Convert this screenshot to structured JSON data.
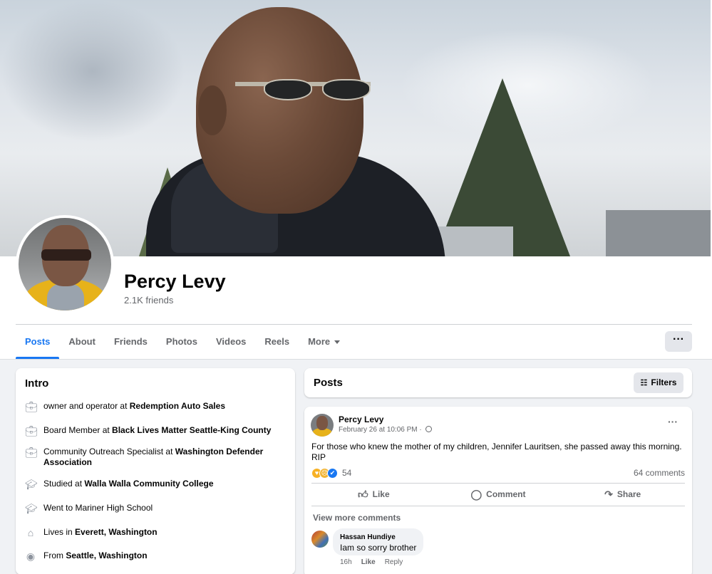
{
  "profile": {
    "name": "Percy Levy",
    "friends": "2.1K friends"
  },
  "tabs": [
    {
      "label": "Posts",
      "active": true
    },
    {
      "label": "About"
    },
    {
      "label": "Friends"
    },
    {
      "label": "Photos"
    },
    {
      "label": "Videos"
    },
    {
      "label": "Reels"
    },
    {
      "label": "More"
    }
  ],
  "more_button": "···",
  "intro": {
    "title": "Intro",
    "items": [
      {
        "icon": "briefcase-icon",
        "text": "owner and operator at ",
        "bold": "Redemption Auto Sales"
      },
      {
        "icon": "briefcase-icon",
        "text": "Board Member at ",
        "bold": "Black Lives Matter Seattle-King County"
      },
      {
        "icon": "briefcase-icon",
        "text": "Community Outreach Specialist at ",
        "bold": "Washington Defender Association"
      },
      {
        "icon": "graduation-cap-icon",
        "text": "Studied at ",
        "bold": "Walla Walla Community College"
      },
      {
        "icon": "graduation-cap-icon",
        "text": "Went to Mariner High School",
        "bold": ""
      },
      {
        "icon": "home-icon",
        "text": "Lives in ",
        "bold": "Everett, Washington"
      },
      {
        "icon": "location-pin-icon",
        "text": "From ",
        "bold": "Seattle, Washington"
      }
    ]
  },
  "posts_header": {
    "title": "Posts",
    "filters_label": "Filters"
  },
  "post": {
    "author": "Percy Levy",
    "time": "February 26 at 10:06 PM ·",
    "text": "For those who knew the mother of my children, Jennifer Lauritsen, she passed away this morning. RIP",
    "reaction_count": "54",
    "comment_count": "64 comments",
    "actions": {
      "like": "Like",
      "comment": "Comment",
      "share": "Share"
    },
    "view_more": "View more comments",
    "comment": {
      "author": "Hassan Hundiye",
      "text": "Iam so sorry brother",
      "time": "16h",
      "like": "Like",
      "reply": "Reply"
    }
  }
}
